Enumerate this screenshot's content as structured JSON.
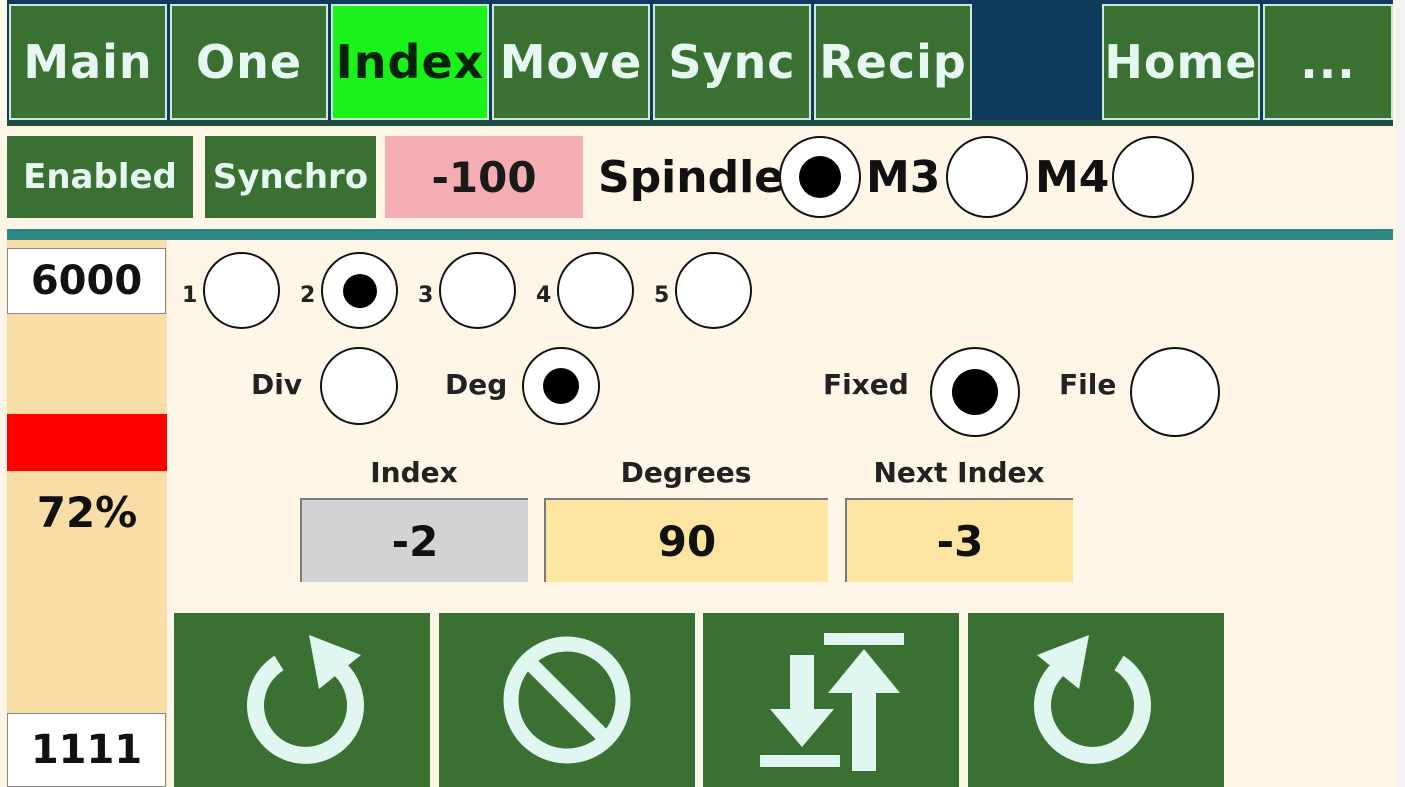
{
  "tabs": [
    {
      "label": "Main",
      "active": false
    },
    {
      "label": "One",
      "active": false
    },
    {
      "label": "Index",
      "active": true
    },
    {
      "label": "Move",
      "active": false
    },
    {
      "label": "Sync",
      "active": false
    },
    {
      "label": "Recip",
      "active": false
    },
    {
      "label": "Home",
      "active": false
    },
    {
      "label": "...",
      "active": false
    }
  ],
  "status": {
    "enabled_label": "Enabled",
    "synchro_label": "Synchro",
    "rpm_value": "-100",
    "spindle_label": "Spindle",
    "spindle_selected": true,
    "m3_label": "M3",
    "m3_selected": false,
    "m4_label": "M4",
    "m4_selected": false
  },
  "left_panel": {
    "max_value": "6000",
    "percent": "72%",
    "bottom_value": "1111"
  },
  "axis_select": {
    "options": [
      "1",
      "2",
      "3",
      "4",
      "5"
    ],
    "selected": "2"
  },
  "mode": {
    "div_label": "Div",
    "deg_label": "Deg",
    "selected": "Deg"
  },
  "source": {
    "fixed_label": "Fixed",
    "file_label": "File",
    "selected": "Fixed"
  },
  "fields": {
    "index_label": "Index",
    "index_value": "-2",
    "degrees_label": "Degrees",
    "degrees_value": "90",
    "next_index_label": "Next Index",
    "next_index_value": "-3"
  },
  "actions": [
    {
      "icon": "rotate-ccw-icon"
    },
    {
      "icon": "stop-icon"
    },
    {
      "icon": "sort-icon"
    },
    {
      "icon": "rotate-cw-icon"
    }
  ],
  "colors": {
    "tab_green": "#3a7132",
    "tab_active": "#19f319",
    "tab_bar_bg": "#0e3b5c",
    "rpm_bg": "#f4aeb1",
    "left_panel_bg": "#f9dda7",
    "alert_red": "#ff0000",
    "field_grey": "#d3d3d3",
    "field_yellow": "#fbe5a0",
    "icon_color": "#dff6f1"
  }
}
